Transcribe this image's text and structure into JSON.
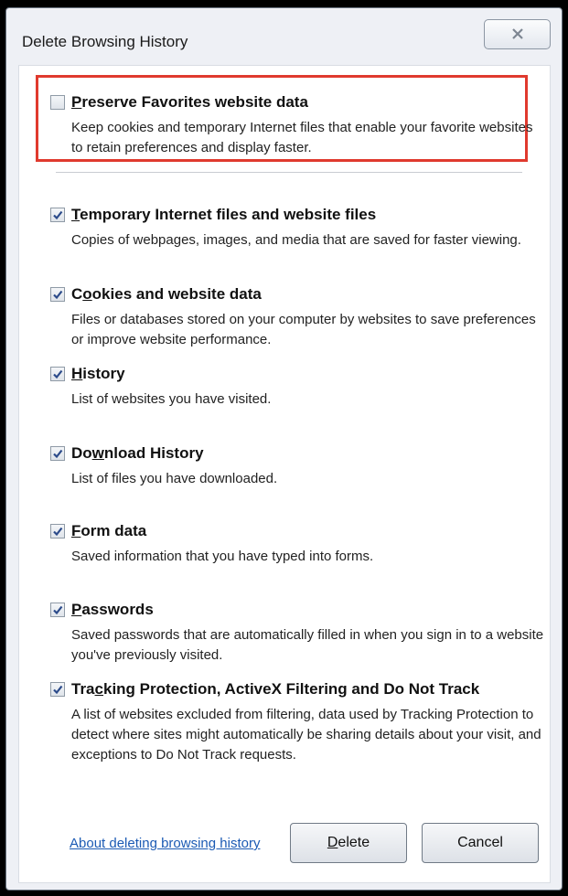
{
  "window": {
    "title": "Delete Browsing History"
  },
  "options": [
    {
      "label": "Preserve Favorites website data",
      "accel_index": 0,
      "checked": false,
      "description": "Keep cookies and temporary Internet files that enable your favorite websites to retain preferences and display faster."
    },
    {
      "label": "Temporary Internet files and website files",
      "accel_index": 0,
      "checked": true,
      "description": "Copies of webpages, images, and media that are saved for faster viewing."
    },
    {
      "label": "Cookies and website data",
      "accel_index": 1,
      "checked": true,
      "description": "Files or databases stored on your computer by websites to save preferences or improve website performance."
    },
    {
      "label": "History",
      "accel_index": 0,
      "checked": true,
      "description": "List of websites you have visited."
    },
    {
      "label": "Download History",
      "accel_index": 2,
      "checked": true,
      "description": "List of files you have downloaded."
    },
    {
      "label": "Form data",
      "accel_index": 0,
      "checked": true,
      "description": "Saved information that you have typed into forms."
    },
    {
      "label": "Passwords",
      "accel_index": 0,
      "checked": true,
      "description": "Saved passwords that are automatically filled in when you sign in to a website you've previously visited."
    },
    {
      "label": "Tracking Protection, ActiveX Filtering and Do Not Track",
      "accel_index": 3,
      "checked": true,
      "description": "A list of websites excluded from filtering, data used by Tracking Protection to detect where sites might automatically be sharing details about your visit, and exceptions to Do Not Track requests."
    }
  ],
  "footer": {
    "link": "About deleting browsing history",
    "delete_label": "Delete",
    "delete_accel_index": 0,
    "cancel_label": "Cancel"
  },
  "colors": {
    "highlight_border": "#e03a2e",
    "link": "#1c5bb4",
    "checkmark": "#2b4a8a"
  }
}
